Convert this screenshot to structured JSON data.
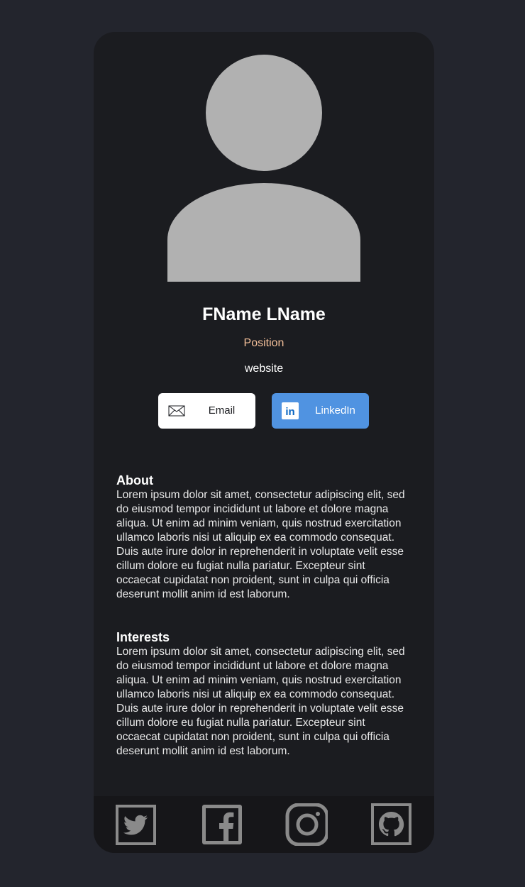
{
  "profile": {
    "name": "FName LName",
    "position": "Position",
    "website": "website"
  },
  "buttons": {
    "email_label": "Email",
    "linkedin_label": "LinkedIn",
    "linkedin_icon_text": "in"
  },
  "about": {
    "heading": "About",
    "text": "Lorem ipsum dolor sit amet, consectetur adipiscing elit, sed do eiusmod tempor incididunt ut labore et dolore magna aliqua. Ut enim ad minim veniam, quis nostrud exercitation ullamco laboris nisi ut aliquip ex ea commodo consequat. Duis aute irure dolor in reprehenderit in voluptate velit esse cillum dolore eu fugiat nulla pariatur. Excepteur sint occaecat cupidatat non proident, sunt in culpa qui officia deserunt mollit anim id est laborum."
  },
  "interests": {
    "heading": "Interests",
    "text": "Lorem ipsum dolor sit amet, consectetur adipiscing elit, sed do eiusmod tempor incididunt ut labore et dolore magna aliqua. Ut enim ad minim veniam, quis nostrud exercitation ullamco laboris nisi ut aliquip ex ea commodo consequat. Duis aute irure dolor in reprehenderit in voluptate velit esse cillum dolore eu fugiat nulla pariatur. Excepteur sint occaecat cupidatat non proident, sunt in culpa qui officia deserunt mollit anim id est laborum."
  },
  "footer": {
    "icons": [
      "twitter-icon",
      "facebook-icon",
      "instagram-icon",
      "github-icon"
    ]
  },
  "colors": {
    "page_background": "#23252d",
    "card_background": "#1b1c20",
    "footer_background": "#161619",
    "position_accent": "#f3bf99",
    "linkedin_button": "#5093e1",
    "avatar_placeholder": "#b1b1b1",
    "social_icon": "#8a8a8a"
  }
}
